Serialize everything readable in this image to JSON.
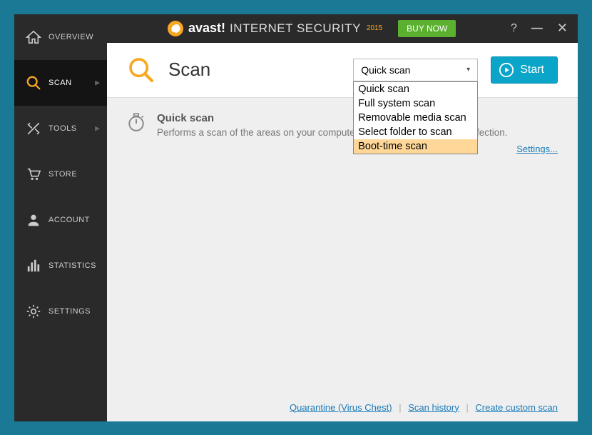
{
  "sidebar": {
    "items": [
      {
        "label": "OVERVIEW"
      },
      {
        "label": "SCAN"
      },
      {
        "label": "TOOLS"
      },
      {
        "label": "STORE"
      },
      {
        "label": "ACCOUNT"
      },
      {
        "label": "STATISTICS"
      },
      {
        "label": "SETTINGS"
      }
    ]
  },
  "titlebar": {
    "brand": "avast!",
    "product": "INTERNET SECURITY",
    "year": "2015",
    "buy": "BUY NOW"
  },
  "page": {
    "title": "Scan",
    "scan_select": "Quick scan",
    "dropdown": [
      "Quick scan",
      "Full system scan",
      "Removable media scan",
      "Select folder to scan",
      "Boot-time scan"
    ],
    "start": "Start",
    "desc_title": "Quick scan",
    "desc_text": "Performs a scan of the areas on your computer most susceptible to virus infection.",
    "settings": "Settings...",
    "footer": {
      "quarantine": "Quarantine (Virus Chest)",
      "history": "Scan history",
      "custom": "Create custom scan"
    }
  }
}
